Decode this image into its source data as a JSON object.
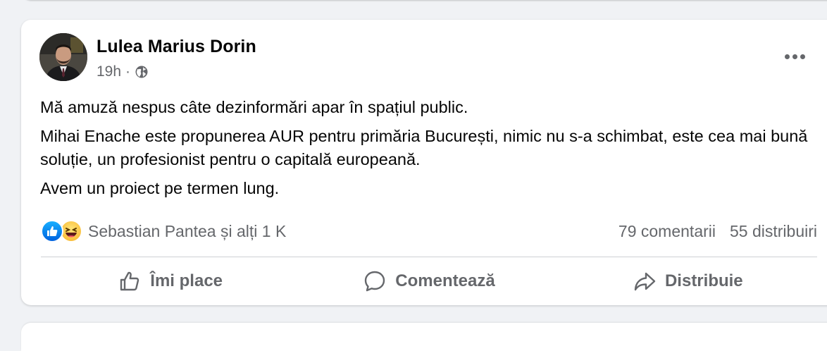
{
  "post": {
    "author": "Lulea Marius Dorin",
    "time": "19h",
    "separator": "·",
    "privacy_icon": "globe-icon",
    "more_icon": "more-options-icon",
    "paragraphs": [
      "Mă amuză nespus câte dezinformări apar în spațiul public.",
      "Mihai Enache este propunerea AUR pentru primăria București, nimic nu s-a schimbat,  este cea mai  bună soluție,  un profesionist pentru o capitală europeană.",
      "Avem un proiect pe termen lung."
    ],
    "reactions": {
      "icons": [
        "like-reaction-icon",
        "haha-reaction-icon"
      ],
      "summary": "Sebastian Pantea și alți 1 K"
    },
    "comments": "79 comentarii",
    "shares": "55 distribuiri",
    "actions": {
      "like": "Îmi place",
      "comment": "Comentează",
      "share": "Distribuie"
    }
  },
  "colors": {
    "background": "#f0f2f5",
    "card": "#ffffff",
    "secondary_text": "#65676b",
    "like_blue": "#1877f2"
  }
}
